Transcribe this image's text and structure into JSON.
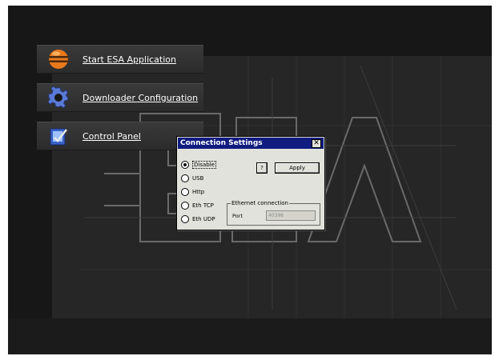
{
  "menu": {
    "items": [
      {
        "label": "Start ESA Application",
        "icon": "esa-ball-icon"
      },
      {
        "label": "Downloader Configuration",
        "icon": "gear-icon"
      },
      {
        "label": "Control Panel",
        "icon": "control-panel-icon"
      }
    ]
  },
  "dialog": {
    "title": "Connection Settings",
    "close_label": "✕",
    "help_label": "?",
    "apply_label": "Apply",
    "options": [
      {
        "label": "Disable",
        "checked": true
      },
      {
        "label": "USB",
        "checked": false
      },
      {
        "label": "Http",
        "checked": false
      },
      {
        "label": "Eth TCP",
        "checked": false
      },
      {
        "label": "Eth UDP",
        "checked": false
      }
    ],
    "ethernet": {
      "legend": "Ethernet connection",
      "port_label": "Port",
      "port_value": "40396"
    }
  },
  "colors": {
    "screen_bg": "#171717",
    "titlebar": "#101c80",
    "dialog_bg": "#e2e2dc"
  }
}
